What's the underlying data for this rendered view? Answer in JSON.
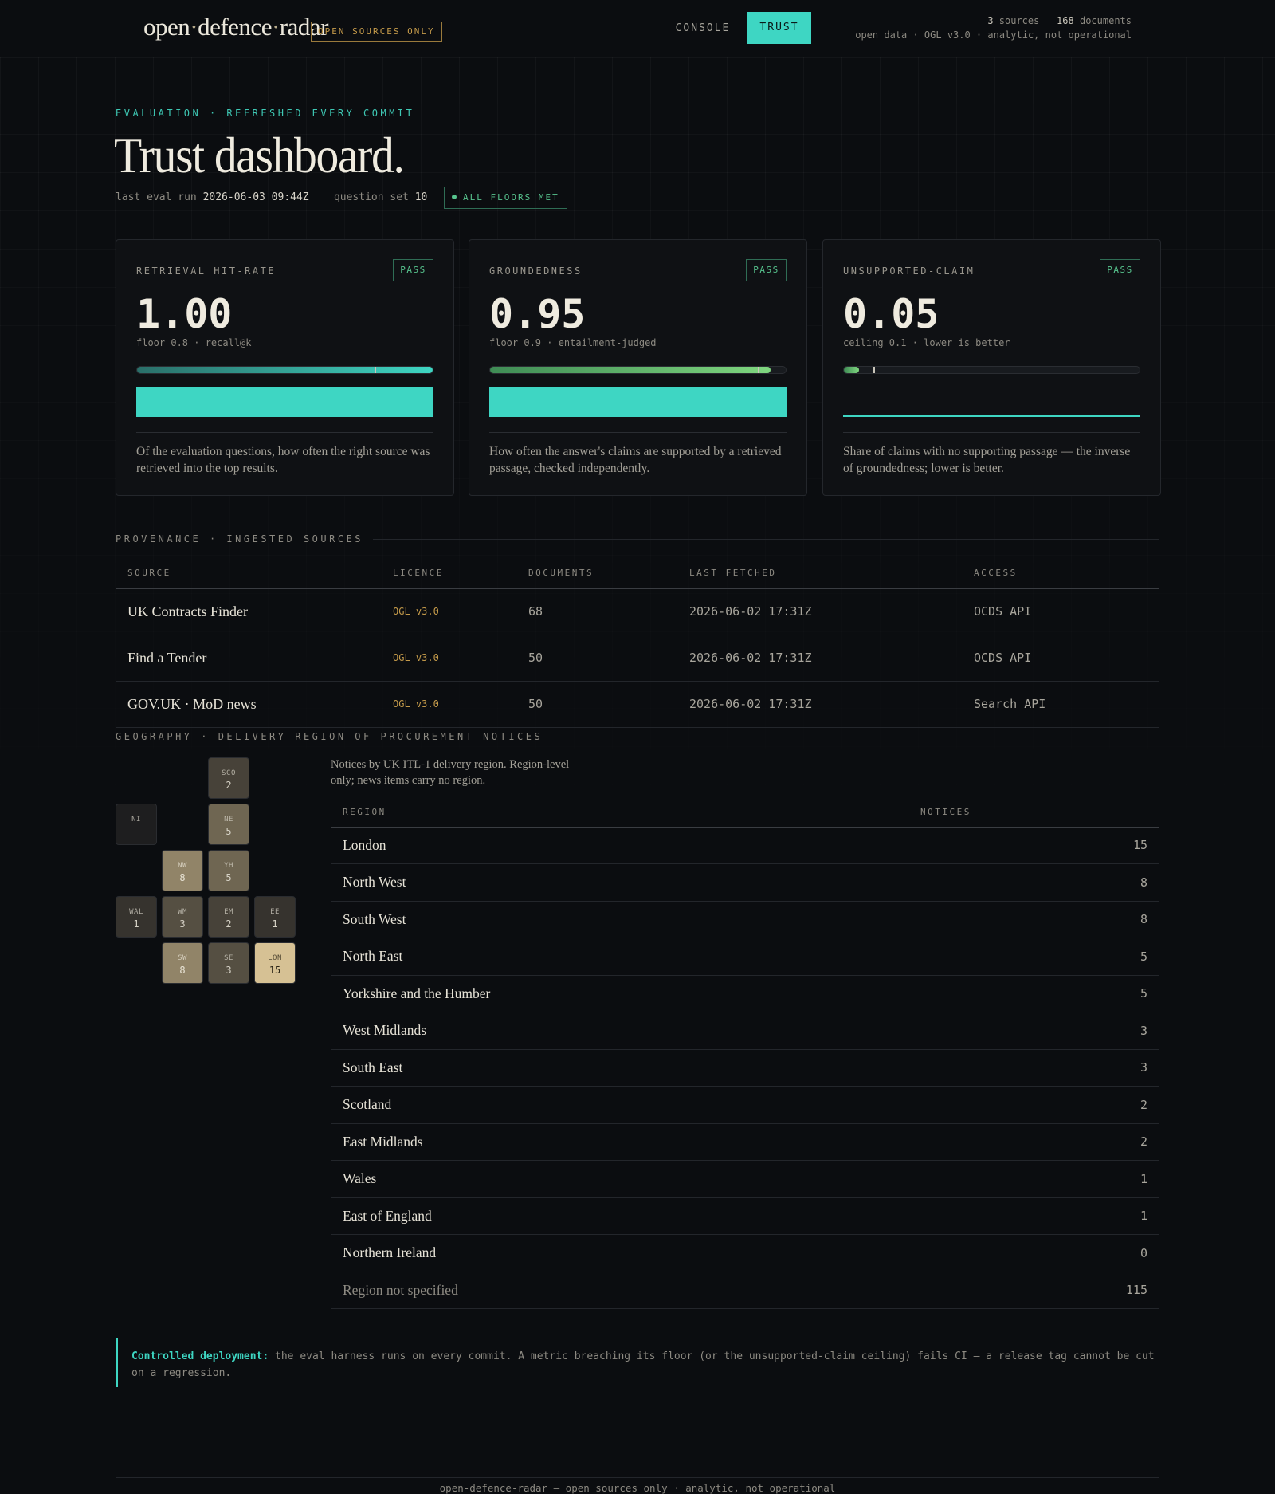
{
  "header": {
    "logo_parts": [
      "open",
      "defence",
      "radar"
    ],
    "logo_separator": "·",
    "tag": "OPEN SOURCES ONLY",
    "nav": {
      "console": "CONSOLE",
      "trust": "TRUST"
    },
    "meta_sources_count": "3",
    "meta_sources_label": "sources",
    "meta_docs_count": "168",
    "meta_docs_label": "documents",
    "meta_line2": "open data · OGL v3.0 · analytic, not operational"
  },
  "hero": {
    "eyebrow": "EVALUATION · REFRESHED EVERY COMMIT",
    "title": "Trust dashboard.",
    "last_run_label": "last eval run",
    "last_run_value": "2026-06-03 09:44Z",
    "question_set_label": "question set",
    "question_set_value": "10",
    "status_badge": "ALL FLOORS MET"
  },
  "metrics": [
    {
      "label": "RETRIEVAL HIT-RATE",
      "status": "PASS",
      "value": "1.00",
      "value_num": 1.0,
      "threshold": 0.8,
      "sub": "floor 0.8 · recall@k",
      "description": "Of the evaluation questions, how often the right source was retrieved into the top results."
    },
    {
      "label": "GROUNDEDNESS",
      "status": "PASS",
      "value": "0.95",
      "value_num": 0.95,
      "threshold": 0.9,
      "sub": "floor 0.9 · entailment-judged",
      "description": "How often the answer's claims are supported by a retrieved passage, checked independently."
    },
    {
      "label": "UNSUPPORTED-CLAIM",
      "status": "PASS",
      "value": "0.05",
      "value_num": 0.05,
      "threshold": 0.1,
      "sub": "ceiling 0.1 · lower is better",
      "description": "Share of claims with no supporting passage — the inverse of groundedness; lower is better."
    }
  ],
  "provenance": {
    "heading": "PROVENANCE · INGESTED SOURCES",
    "columns": [
      "SOURCE",
      "LICENCE",
      "DOCUMENTS",
      "LAST FETCHED",
      "ACCESS"
    ],
    "rows": [
      {
        "source": "UK Contracts Finder",
        "licence": "OGL v3.0",
        "documents": "68",
        "fetched": "2026-06-02 17:31Z",
        "access": "OCDS API"
      },
      {
        "source": "Find a Tender",
        "licence": "OGL v3.0",
        "documents": "50",
        "fetched": "2026-06-02 17:31Z",
        "access": "OCDS API"
      },
      {
        "source": "GOV.UK · MoD news",
        "licence": "OGL v3.0",
        "documents": "50",
        "fetched": "2026-06-02 17:31Z",
        "access": "Search API"
      }
    ]
  },
  "geography": {
    "heading": "GEOGRAPHY · DELIVERY REGION OF PROCUREMENT NOTICES",
    "note": "Notices by UK ITL-1 delivery region. Region-level only; news items carry no region.",
    "tiles": [
      {
        "code": "SCO",
        "count": "2",
        "col": 2,
        "row": 0
      },
      {
        "code": "NI",
        "count": "",
        "col": 0,
        "row": 1
      },
      {
        "code": "NE",
        "count": "5",
        "col": 2,
        "row": 1
      },
      {
        "code": "NW",
        "count": "8",
        "col": 1,
        "row": 2
      },
      {
        "code": "YH",
        "count": "5",
        "col": 2,
        "row": 2
      },
      {
        "code": "WAL",
        "count": "1",
        "col": 0,
        "row": 3
      },
      {
        "code": "WM",
        "count": "3",
        "col": 1,
        "row": 3
      },
      {
        "code": "EM",
        "count": "2",
        "col": 2,
        "row": 3
      },
      {
        "code": "EE",
        "count": "1",
        "col": 3,
        "row": 3
      },
      {
        "code": "SW",
        "count": "8",
        "col": 1,
        "row": 4
      },
      {
        "code": "SE",
        "count": "3",
        "col": 2,
        "row": 4
      },
      {
        "code": "LON",
        "count": "15",
        "col": 3,
        "row": 4
      }
    ],
    "columns": [
      "REGION",
      "NOTICES"
    ],
    "rows": [
      {
        "region": "London",
        "notices": "15"
      },
      {
        "region": "North West",
        "notices": "8"
      },
      {
        "region": "South West",
        "notices": "8"
      },
      {
        "region": "North East",
        "notices": "5"
      },
      {
        "region": "Yorkshire and the Humber",
        "notices": "5"
      },
      {
        "region": "West Midlands",
        "notices": "3"
      },
      {
        "region": "South East",
        "notices": "3"
      },
      {
        "region": "Scotland",
        "notices": "2"
      },
      {
        "region": "East Midlands",
        "notices": "2"
      },
      {
        "region": "Wales",
        "notices": "1"
      },
      {
        "region": "East of England",
        "notices": "1"
      },
      {
        "region": "Northern Ireland",
        "notices": "0"
      },
      {
        "region": "Region not specified",
        "notices": "115",
        "muted": true
      }
    ]
  },
  "callout": {
    "lead": "Controlled deployment:",
    "text": "the eval harness runs on every commit. A metric breaching its floor (or the unsupported-claim ceiling) fails CI — a release tag cannot be cut on a regression."
  },
  "footer": "open-defence-radar — open sources only · analytic, not operational",
  "colors": {
    "accent": "#3ed6c3",
    "pass": "#57c48e",
    "licence": "#c49a4a",
    "background": "#0b0d10"
  }
}
